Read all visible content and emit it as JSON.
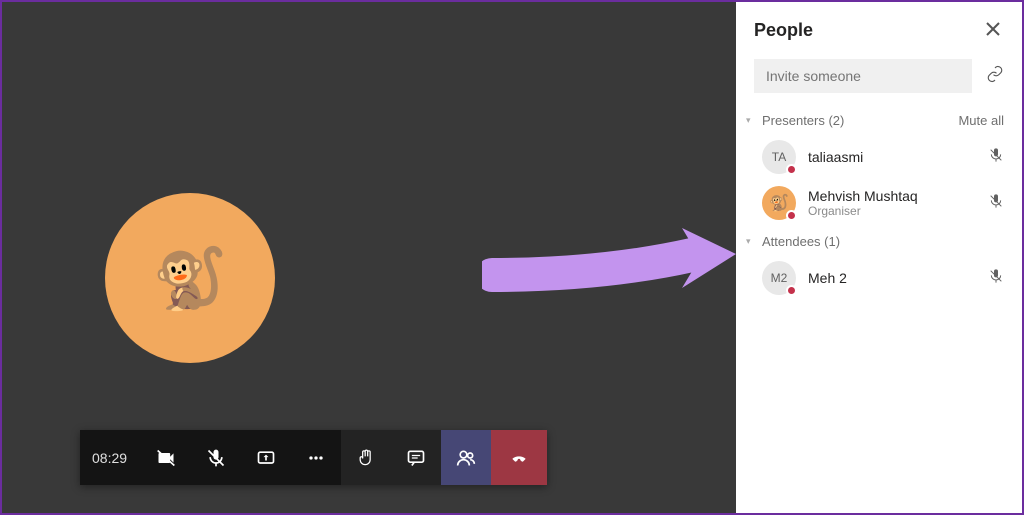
{
  "toolbar": {
    "time": "08:29"
  },
  "avatar_emoji": "🐒",
  "panel": {
    "title": "People",
    "invite_placeholder": "Invite someone",
    "mute_all": "Mute all",
    "sections": {
      "presenters": {
        "label": "Presenters (2)"
      },
      "attendees": {
        "label": "Attendees (1)"
      }
    },
    "people": {
      "p0": {
        "initials": "TA",
        "name": "taliaasmi",
        "sub": ""
      },
      "p1": {
        "initials": "",
        "name": "Mehvish Mushtaq",
        "sub": "Organiser"
      },
      "p2": {
        "initials": "M2",
        "name": "Meh 2",
        "sub": ""
      }
    }
  },
  "colors": {
    "accent": "#464775",
    "hangup": "#9d3743",
    "avatar_bg": "#f2a95e",
    "arrow": "#c394ee"
  }
}
